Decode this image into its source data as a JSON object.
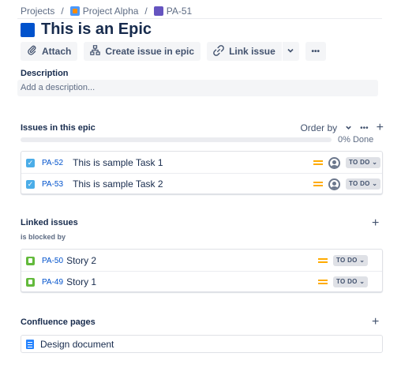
{
  "breadcrumbs": {
    "root": "Projects",
    "separator": "/",
    "project": "Project Alpha",
    "current": "PA-51"
  },
  "epic": {
    "title": "This is an Epic"
  },
  "toolbar": {
    "attach": "Attach",
    "create_issue": "Create issue in epic",
    "link_issue": "Link issue",
    "more": "•••"
  },
  "description": {
    "label": "Description",
    "placeholder": "Add a description..."
  },
  "issues_in_epic": {
    "label": "Issues in this epic",
    "order_by": "Order by",
    "progress_text": "0% Done",
    "progress": 0,
    "items": [
      {
        "key": "PA-52",
        "summary": "This is sample Task 1",
        "status": "TO DO"
      },
      {
        "key": "PA-53",
        "summary": "This is sample Task 2",
        "status": "TO DO"
      }
    ]
  },
  "linked_issues": {
    "label": "Linked issues",
    "relation": "is blocked by",
    "items": [
      {
        "key": "PA-50",
        "summary": "Story 2",
        "status": "TO DO"
      },
      {
        "key": "PA-49",
        "summary": "Story 1",
        "status": "TO DO"
      }
    ]
  },
  "confluence": {
    "label": "Confluence pages",
    "items": [
      {
        "title": "Design document"
      }
    ]
  },
  "colors": {
    "epic": "#0052cc",
    "link": "#0052cc",
    "priority_medium": "#ffab00",
    "task": "#4bade8",
    "story": "#63ba3c"
  }
}
